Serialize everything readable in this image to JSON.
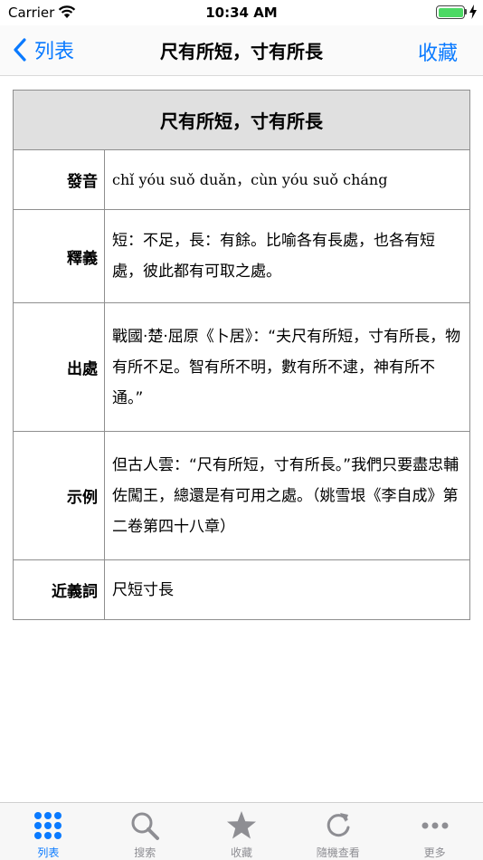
{
  "status_bar": {
    "carrier": "Carrier",
    "time": "10:34 AM"
  },
  "nav": {
    "back_label": "列表",
    "title": "尺有所短，寸有所長",
    "favorite_label": "收藏"
  },
  "entry": {
    "header": "尺有所短，寸有所長",
    "rows": [
      {
        "label": "發音",
        "value": "chǐ yóu suǒ duǎn，cùn yóu suǒ cháng"
      },
      {
        "label": "釋義",
        "value": "短：不足，長：有餘。比喻各有長處，也各有短處，彼此都有可取之處。"
      },
      {
        "label": "出處",
        "value": "戰國·楚·屈原《卜居》：“夫尺有所短，寸有所長，物有所不足。智有所不明，數有所不逮，神有所不通。”"
      },
      {
        "label": "示例",
        "value": "但古人雲：“尺有所短，寸有所長。”我們只要盡忠輔佐闖王，總還是有可用之處。（姚雪垠《李自成》第二卷第四十八章）"
      },
      {
        "label": "近義詞",
        "value": "尺短寸長"
      }
    ]
  },
  "tabs": [
    {
      "label": "列表",
      "icon": "grid-icon",
      "active": true
    },
    {
      "label": "搜索",
      "icon": "search-icon",
      "active": false
    },
    {
      "label": "收藏",
      "icon": "star-icon",
      "active": false
    },
    {
      "label": "隨機查看",
      "icon": "refresh-icon",
      "active": false
    },
    {
      "label": "更多",
      "icon": "more-icon",
      "active": false
    }
  ],
  "colors": {
    "accent": "#0a7aff",
    "inactive": "#8e8e93",
    "header_bg": "#e0e0e0",
    "battery": "#4cd964"
  }
}
